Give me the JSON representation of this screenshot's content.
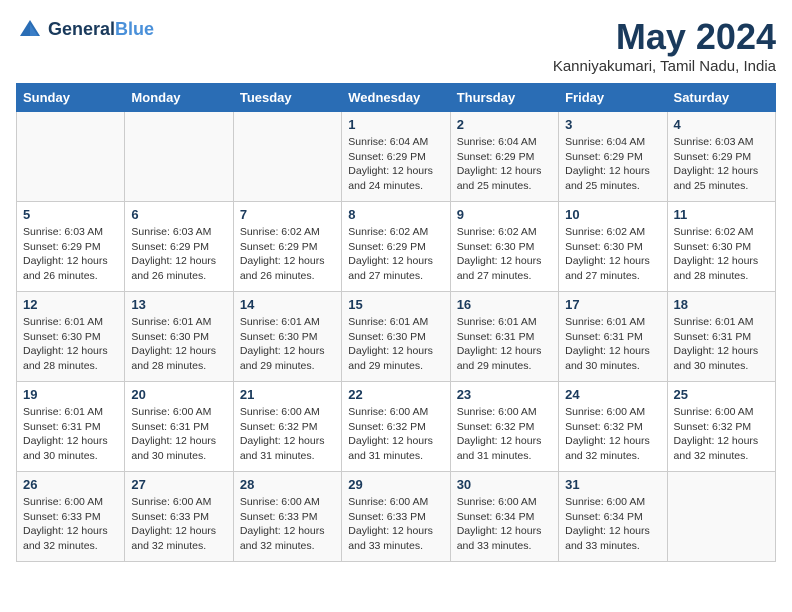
{
  "logo": {
    "line1": "General",
    "line2": "Blue"
  },
  "title": "May 2024",
  "location": "Kanniyakumari, Tamil Nadu, India",
  "weekdays": [
    "Sunday",
    "Monday",
    "Tuesday",
    "Wednesday",
    "Thursday",
    "Friday",
    "Saturday"
  ],
  "weeks": [
    [
      {
        "day": "",
        "info": ""
      },
      {
        "day": "",
        "info": ""
      },
      {
        "day": "",
        "info": ""
      },
      {
        "day": "1",
        "info": "Sunrise: 6:04 AM\nSunset: 6:29 PM\nDaylight: 12 hours\nand 24 minutes."
      },
      {
        "day": "2",
        "info": "Sunrise: 6:04 AM\nSunset: 6:29 PM\nDaylight: 12 hours\nand 25 minutes."
      },
      {
        "day": "3",
        "info": "Sunrise: 6:04 AM\nSunset: 6:29 PM\nDaylight: 12 hours\nand 25 minutes."
      },
      {
        "day": "4",
        "info": "Sunrise: 6:03 AM\nSunset: 6:29 PM\nDaylight: 12 hours\nand 25 minutes."
      }
    ],
    [
      {
        "day": "5",
        "info": "Sunrise: 6:03 AM\nSunset: 6:29 PM\nDaylight: 12 hours\nand 26 minutes."
      },
      {
        "day": "6",
        "info": "Sunrise: 6:03 AM\nSunset: 6:29 PM\nDaylight: 12 hours\nand 26 minutes."
      },
      {
        "day": "7",
        "info": "Sunrise: 6:02 AM\nSunset: 6:29 PM\nDaylight: 12 hours\nand 26 minutes."
      },
      {
        "day": "8",
        "info": "Sunrise: 6:02 AM\nSunset: 6:29 PM\nDaylight: 12 hours\nand 27 minutes."
      },
      {
        "day": "9",
        "info": "Sunrise: 6:02 AM\nSunset: 6:30 PM\nDaylight: 12 hours\nand 27 minutes."
      },
      {
        "day": "10",
        "info": "Sunrise: 6:02 AM\nSunset: 6:30 PM\nDaylight: 12 hours\nand 27 minutes."
      },
      {
        "day": "11",
        "info": "Sunrise: 6:02 AM\nSunset: 6:30 PM\nDaylight: 12 hours\nand 28 minutes."
      }
    ],
    [
      {
        "day": "12",
        "info": "Sunrise: 6:01 AM\nSunset: 6:30 PM\nDaylight: 12 hours\nand 28 minutes."
      },
      {
        "day": "13",
        "info": "Sunrise: 6:01 AM\nSunset: 6:30 PM\nDaylight: 12 hours\nand 28 minutes."
      },
      {
        "day": "14",
        "info": "Sunrise: 6:01 AM\nSunset: 6:30 PM\nDaylight: 12 hours\nand 29 minutes."
      },
      {
        "day": "15",
        "info": "Sunrise: 6:01 AM\nSunset: 6:30 PM\nDaylight: 12 hours\nand 29 minutes."
      },
      {
        "day": "16",
        "info": "Sunrise: 6:01 AM\nSunset: 6:31 PM\nDaylight: 12 hours\nand 29 minutes."
      },
      {
        "day": "17",
        "info": "Sunrise: 6:01 AM\nSunset: 6:31 PM\nDaylight: 12 hours\nand 30 minutes."
      },
      {
        "day": "18",
        "info": "Sunrise: 6:01 AM\nSunset: 6:31 PM\nDaylight: 12 hours\nand 30 minutes."
      }
    ],
    [
      {
        "day": "19",
        "info": "Sunrise: 6:01 AM\nSunset: 6:31 PM\nDaylight: 12 hours\nand 30 minutes."
      },
      {
        "day": "20",
        "info": "Sunrise: 6:00 AM\nSunset: 6:31 PM\nDaylight: 12 hours\nand 30 minutes."
      },
      {
        "day": "21",
        "info": "Sunrise: 6:00 AM\nSunset: 6:32 PM\nDaylight: 12 hours\nand 31 minutes."
      },
      {
        "day": "22",
        "info": "Sunrise: 6:00 AM\nSunset: 6:32 PM\nDaylight: 12 hours\nand 31 minutes."
      },
      {
        "day": "23",
        "info": "Sunrise: 6:00 AM\nSunset: 6:32 PM\nDaylight: 12 hours\nand 31 minutes."
      },
      {
        "day": "24",
        "info": "Sunrise: 6:00 AM\nSunset: 6:32 PM\nDaylight: 12 hours\nand 32 minutes."
      },
      {
        "day": "25",
        "info": "Sunrise: 6:00 AM\nSunset: 6:32 PM\nDaylight: 12 hours\nand 32 minutes."
      }
    ],
    [
      {
        "day": "26",
        "info": "Sunrise: 6:00 AM\nSunset: 6:33 PM\nDaylight: 12 hours\nand 32 minutes."
      },
      {
        "day": "27",
        "info": "Sunrise: 6:00 AM\nSunset: 6:33 PM\nDaylight: 12 hours\nand 32 minutes."
      },
      {
        "day": "28",
        "info": "Sunrise: 6:00 AM\nSunset: 6:33 PM\nDaylight: 12 hours\nand 32 minutes."
      },
      {
        "day": "29",
        "info": "Sunrise: 6:00 AM\nSunset: 6:33 PM\nDaylight: 12 hours\nand 33 minutes."
      },
      {
        "day": "30",
        "info": "Sunrise: 6:00 AM\nSunset: 6:34 PM\nDaylight: 12 hours\nand 33 minutes."
      },
      {
        "day": "31",
        "info": "Sunrise: 6:00 AM\nSunset: 6:34 PM\nDaylight: 12 hours\nand 33 minutes."
      },
      {
        "day": "",
        "info": ""
      }
    ]
  ]
}
